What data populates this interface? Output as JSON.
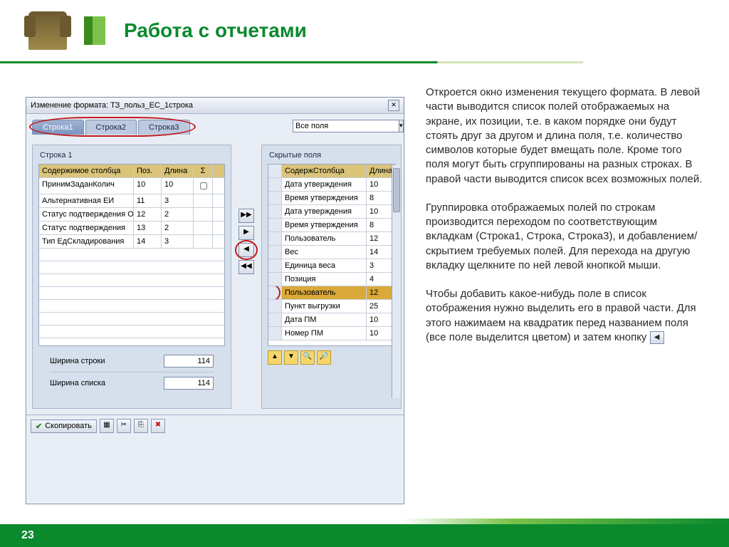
{
  "header": {
    "title": "Работа с отчетами"
  },
  "slide_number": "23",
  "sap": {
    "window_title": "Изменение формата: ТЗ_польз_ЕС_1строка",
    "tabs": [
      "Строка1",
      "Строка2",
      "Строка3"
    ],
    "all_fields_label": "Все поля",
    "left_panel": {
      "title": "Строка 1",
      "headers": [
        "Содержимое столбца",
        "Поз.",
        "Длина",
        "Σ"
      ],
      "rows": [
        {
          "name": "ПринимЗаданКолич",
          "pos": "10",
          "len": "10",
          "sum": true
        },
        {
          "name": "Альтернативная ЕИ",
          "pos": "11",
          "len": "3"
        },
        {
          "name": "Статус подтверждения Отг",
          "pos": "12",
          "len": "2"
        },
        {
          "name": "Статус подтверждения",
          "pos": "13",
          "len": "2"
        },
        {
          "name": "Тип ЕдСкладирования",
          "pos": "14",
          "len": "3"
        }
      ],
      "line_width_label": "Ширина строки",
      "line_width_value": "114",
      "list_width_label": "Ширина списка",
      "list_width_value": "114"
    },
    "right_panel": {
      "title": "Скрытые поля",
      "headers": [
        "СодержСтолбца",
        "Длина"
      ],
      "rows": [
        {
          "name": "Дата утверждения",
          "len": "10"
        },
        {
          "name": "Время утверждения",
          "len": "8"
        },
        {
          "name": "Дата утверждения",
          "len": "10"
        },
        {
          "name": "Время утверждения",
          "len": "8"
        },
        {
          "name": "Пользователь",
          "len": "12"
        },
        {
          "name": "Вес",
          "len": "14"
        },
        {
          "name": "Единица веса",
          "len": "3"
        },
        {
          "name": "Позиция",
          "len": "4"
        },
        {
          "name": "Пользователь",
          "len": "12",
          "highlight": true
        },
        {
          "name": "Пункт выгрузки",
          "len": "25"
        },
        {
          "name": "Дата ПМ",
          "len": "10"
        },
        {
          "name": "Номер ПМ",
          "len": "10"
        }
      ]
    },
    "copy_button": "Скопировать"
  },
  "text": {
    "p1": "Откроется окно изменения текущего формата. В левой части выводится список полей отображаемых на экране, их позиции, т.е. в каком порядке они будут стоять друг за другом и длина поля, т.е. количество символов которые будет вмещать поле. Кроме того поля могут быть сгруппированы на разных строках. В правой части выводится список всех возможных полей.",
    "p2": "Группировка отображаемых полей по строкам производится переходом по соответствующим вкладкам (Строка1, Строка, Строка3), и добавлением/скрытием требуемых полей. Для перехода на другую вкладку щелкните по ней левой кнопкой мыши.",
    "p3a": "Чтобы добавить какое-нибудь поле в список отображения нужно выделить его в правой части. Для этого нажимаем на квадратик перед названием поля (все поле выделится цветом) и затем кнопку"
  }
}
